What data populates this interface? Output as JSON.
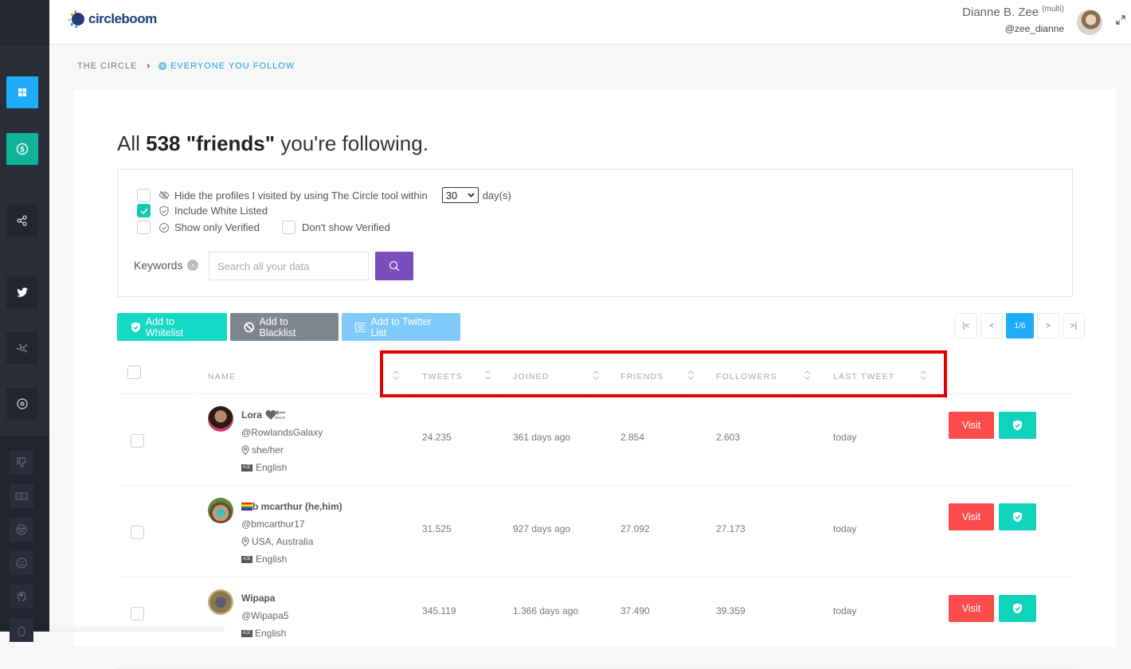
{
  "app": {
    "brand": "circleboom"
  },
  "user": {
    "name": "Dianne B. Zee",
    "badge": "(multi)",
    "handle": "@zee_dianne"
  },
  "sidebar": {
    "main_items": [
      {
        "name": "dashboard",
        "icon": "grid-icon"
      },
      {
        "name": "pricing",
        "icon": "dollar-badge-icon"
      },
      {
        "name": "share",
        "icon": "share-icon"
      },
      {
        "name": "twitter",
        "icon": "twitter-icon"
      },
      {
        "name": "network",
        "icon": "network-icon"
      },
      {
        "name": "circle",
        "icon": "target-icon"
      }
    ],
    "sub_items": [
      {
        "name": "dislike",
        "icon": "thumbs-down-icon"
      },
      {
        "name": "language",
        "icon": "language-icon"
      },
      {
        "name": "eyes-face",
        "icon": "face-icon"
      },
      {
        "name": "neutral-face",
        "icon": "neutral-face-icon"
      },
      {
        "name": "mind",
        "icon": "head-icon"
      },
      {
        "name": "more",
        "icon": "bulb-icon"
      }
    ]
  },
  "breadcrumb": {
    "root": "THE CIRCLE",
    "current": "EVERYONE YOU FOLLOW"
  },
  "page": {
    "title_prefix": "All",
    "title_count": "538 \"friends\"",
    "title_suffix": "you're following."
  },
  "filters": {
    "hide_visited": {
      "label": "Hide the profiles I visited by using The Circle tool within",
      "checked": false,
      "days_value": "30",
      "days_unit": "day(s)"
    },
    "include_whitelisted": {
      "label": "Include White Listed",
      "checked": true
    },
    "only_verified": {
      "label": "Show only Verified",
      "checked": false
    },
    "dont_show_verified": {
      "label": "Don't show Verified",
      "checked": false
    },
    "keywords_label": "Keywords",
    "search_placeholder": "Search all your data",
    "search_value": ""
  },
  "actions": {
    "whitelist": "Add to Whitelist",
    "blacklist": "Add to Blacklist",
    "twitter_list": "Add to Twitter List"
  },
  "pagination": {
    "first": "|<",
    "prev": "<",
    "current": "1/6",
    "next": ">",
    "last": ">|"
  },
  "table": {
    "columns": [
      "NAME",
      "TWEETS",
      "JOINED",
      "FRIENDS",
      "FOLLOWERS",
      "LAST TWEET"
    ],
    "rows": [
      {
        "name": "Lora",
        "name_extra": "follow-back badge",
        "handle": "@RowlandsGalaxy",
        "location": "she/her",
        "language": "English",
        "tweets": "24.235",
        "joined": "361 days ago",
        "friends": "2.854",
        "followers": "2.603",
        "last_tweet": "today",
        "visit": "Visit"
      },
      {
        "name": "b mcarthur (he,him)",
        "name_prefix": "rainbow-flag",
        "handle": "@bmcarthur17",
        "location": "USA, Australia",
        "language": "English",
        "tweets": "31.525",
        "joined": "927 days ago",
        "friends": "27.092",
        "followers": "27.173",
        "last_tweet": "today",
        "visit": "Visit"
      },
      {
        "name": "Wipapa",
        "handle": "@Wipapa5",
        "language": "English",
        "tweets": "345.119",
        "joined": "1.366 days ago",
        "friends": "37.490",
        "followers": "39.359",
        "last_tweet": "today",
        "visit": "Visit"
      }
    ]
  },
  "colors": {
    "sidebar_bg": "#2a2e39",
    "primary_blue": "#1fadfb",
    "teal": "#10b29a",
    "whitelist": "#16d9c5",
    "blacklist": "#7f858e",
    "twitter_list": "#80cbfb",
    "search_btn": "#7b4fbb",
    "visit": "#fd4b4b",
    "highlight": "#e60000"
  }
}
